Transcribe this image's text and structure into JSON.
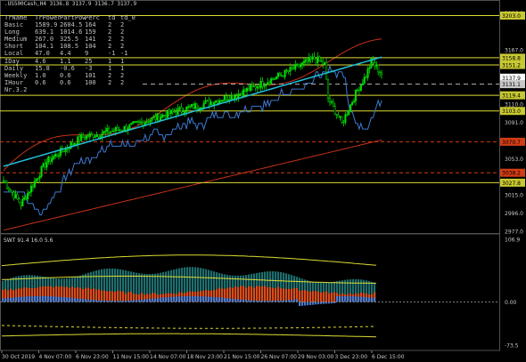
{
  "header": {
    "symbol_line": ".US500Cash,H4  3136.8 3137.9 3136.7 3137.9"
  },
  "table": {
    "columns": [
      "TrName",
      "TrPower",
      "PartPow",
      "Perc",
      "td",
      "td_0"
    ],
    "rows": [
      [
        "Basic",
        "1589.9",
        "2604.5",
        "164",
        "2",
        "2"
      ],
      [
        "Long",
        "639.1",
        "1014.6",
        "159",
        "2",
        "2"
      ],
      [
        "Medium",
        "267.0",
        "325.5",
        "141",
        "2",
        "2"
      ],
      [
        "Short",
        "104.1",
        "108.5",
        "104",
        "2",
        "2"
      ],
      [
        "Local",
        "47.0",
        "4.4",
        "9",
        "-1",
        "-1"
      ],
      [
        "IDay",
        "4.6",
        "1.1",
        "25",
        "1",
        "1"
      ],
      [
        "Daily",
        "15.8",
        "-0.6",
        "-3",
        "1",
        "1"
      ],
      [
        "Weekly",
        "1.0",
        "0.6",
        "101",
        "2",
        "2"
      ],
      [
        "IHour",
        "0.6",
        "0.6",
        "100",
        "2",
        "2"
      ],
      [
        "Nr.3.2",
        "",
        "",
        "",
        "",
        ""
      ]
    ]
  },
  "price_axis": {
    "ticks": [
      "3206.0",
      "3167.0",
      "3137.9",
      "3110.0",
      "3091.0",
      "3053.0",
      "3015.0",
      "2996.0",
      "2977.0"
    ],
    "tags": [
      {
        "value": "3203.0",
        "color": "#c8c832"
      },
      {
        "value": "3158.8",
        "color": "#c8c832"
      },
      {
        "value": "3151.2",
        "color": "#c8c832"
      },
      {
        "value": "3137.9",
        "color": "#ffffff"
      },
      {
        "value": "3131.1",
        "color": "#c8c8c8"
      },
      {
        "value": "3119.4",
        "color": "#c8c832"
      },
      {
        "value": "3103.0",
        "color": "#c8c832"
      },
      {
        "value": "3070.7",
        "color": "#d23c14"
      },
      {
        "value": "3038.2",
        "color": "#d23c14"
      },
      {
        "value": "3027.8",
        "color": "#c8c832"
      }
    ]
  },
  "indicator": {
    "label": "SWT 91.4 16.0 5.6",
    "ticks": [
      "106.9",
      "0.00",
      "-73.5"
    ]
  },
  "time_axis": {
    "labels": [
      "30 Oct 2019",
      "4 Nov 07:00",
      "6 Nov 23:00",
      "11 Nov 15:00",
      "14 Nov 07:00",
      "18 Nov 23:00",
      "21 Nov 15:00",
      "26 Nov 07:00",
      "29 Nov 03:00",
      "3 Dec 23:00",
      "6 Dec 15:00"
    ]
  },
  "colors": {
    "candles": "#00dc00",
    "ma_cyan": "#20c0d8",
    "envelope_red": "#c83218",
    "channel_blue": "#3c7ad2",
    "level_yellow": "#dcdc32",
    "level_red": "#d23c14"
  }
}
